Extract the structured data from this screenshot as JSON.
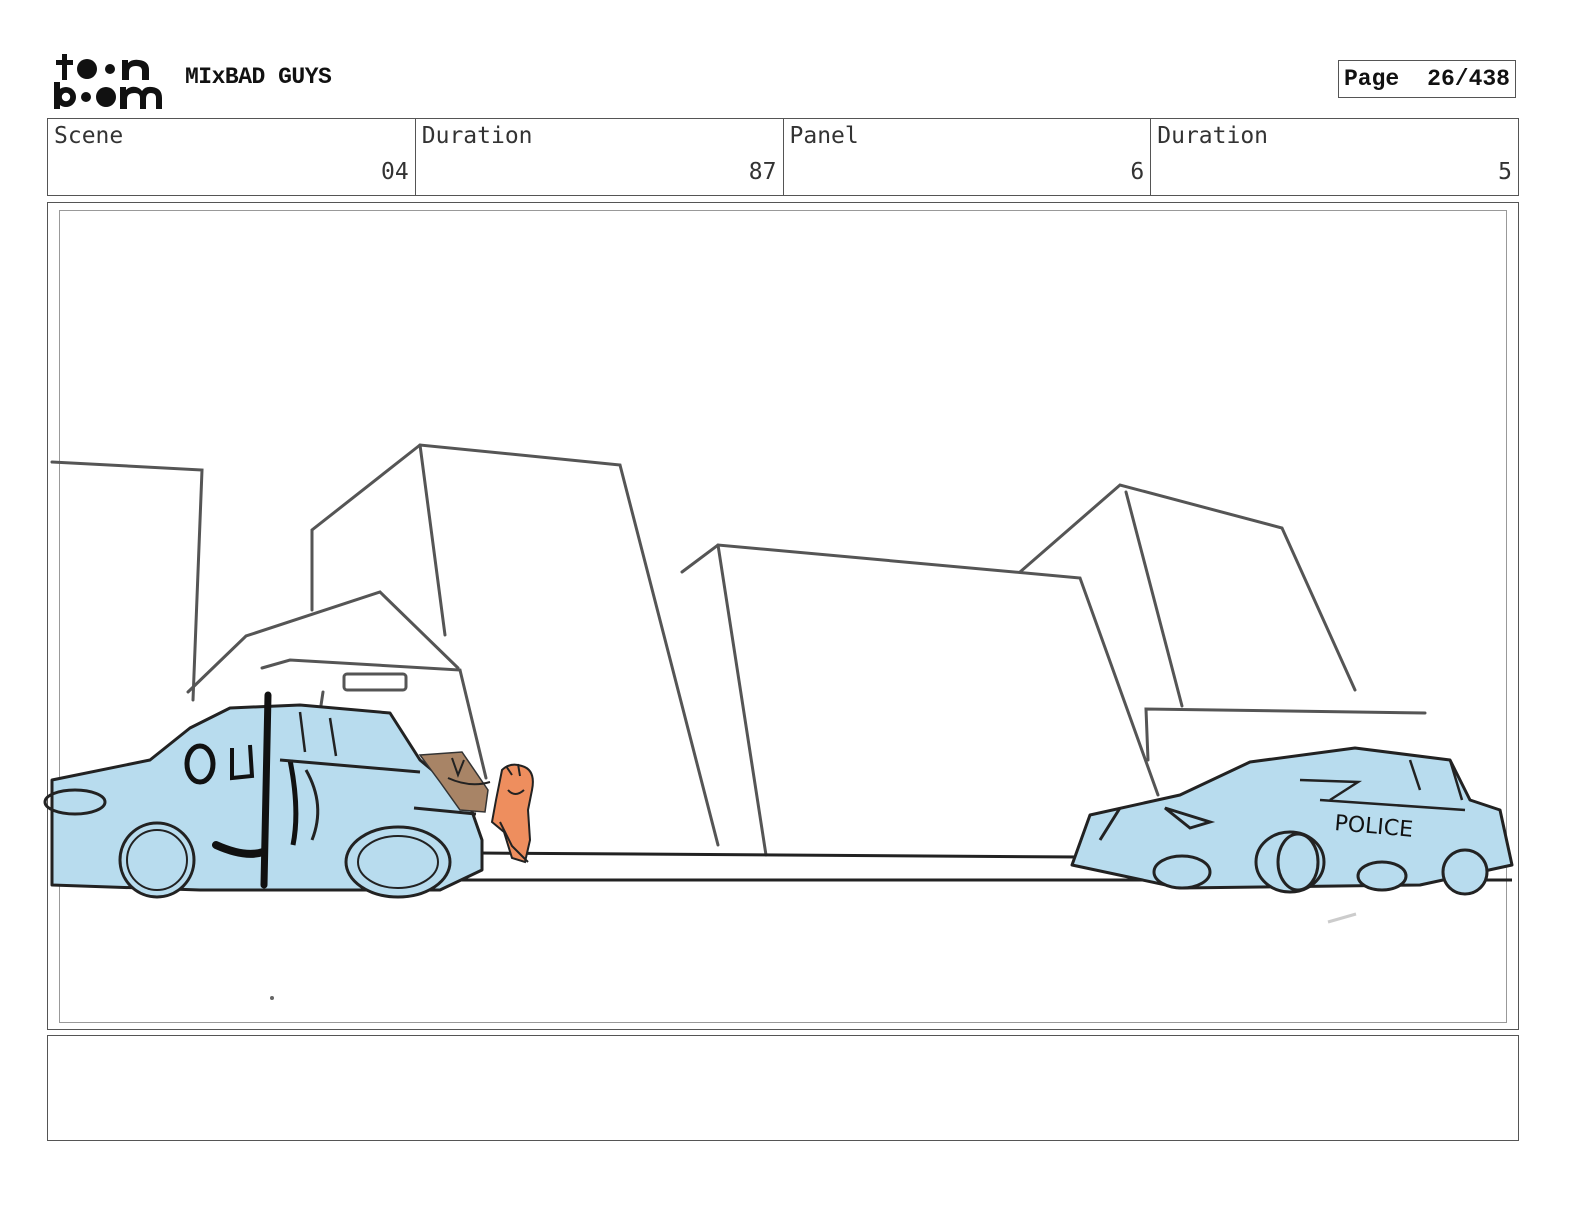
{
  "header": {
    "project_title": "MIxBAD GUYS",
    "page_label": "Page",
    "page_number": "26/438"
  },
  "info": {
    "scene_label": "Scene",
    "scene_value": "04",
    "scene_duration_label": "Duration",
    "scene_duration_value": "87",
    "panel_label": "Panel",
    "panel_value": "6",
    "panel_duration_label": "Duration",
    "panel_duration_value": "5"
  },
  "panel": {
    "police_text": "POLICE"
  },
  "notes": {
    "text": ""
  },
  "colors": {
    "car_fill": "#b8dcee",
    "character_orange": "#ee8e5e",
    "character_brown": "#a88466",
    "sketch_line": "#222222",
    "building_line": "#555555"
  }
}
